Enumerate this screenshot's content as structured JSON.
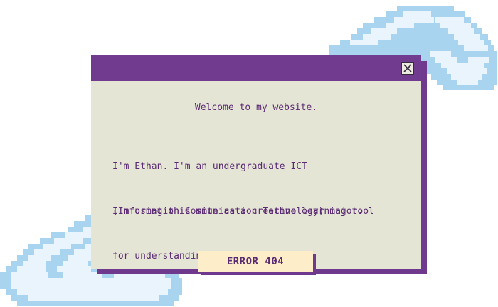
{
  "colors": {
    "titlebar": "#713b8f",
    "window_bg": "#e5e5d6",
    "text": "#5a2a73",
    "button_bg": "#fdedc8",
    "shadow": "#6f3a8e",
    "cloud_light": "#eaf4fc",
    "cloud_mid": "#a9d4ef"
  },
  "window": {
    "close_icon": "close-x-icon",
    "welcome": "Welcome to my website.",
    "intro_lines": [
      "I'm Ethan. I'm an undergraduate ICT",
      "(Information Communication Technology) major."
    ],
    "purpose_lines": [
      "I'm using this site as a creative learning tool",
      "for understanding web development."
    ],
    "error_button": "ERROR 404"
  },
  "decor": {
    "top_cloud_icon": "pixel-cloud-icon",
    "bottom_cloud_icon": "pixel-cloud-icon"
  }
}
